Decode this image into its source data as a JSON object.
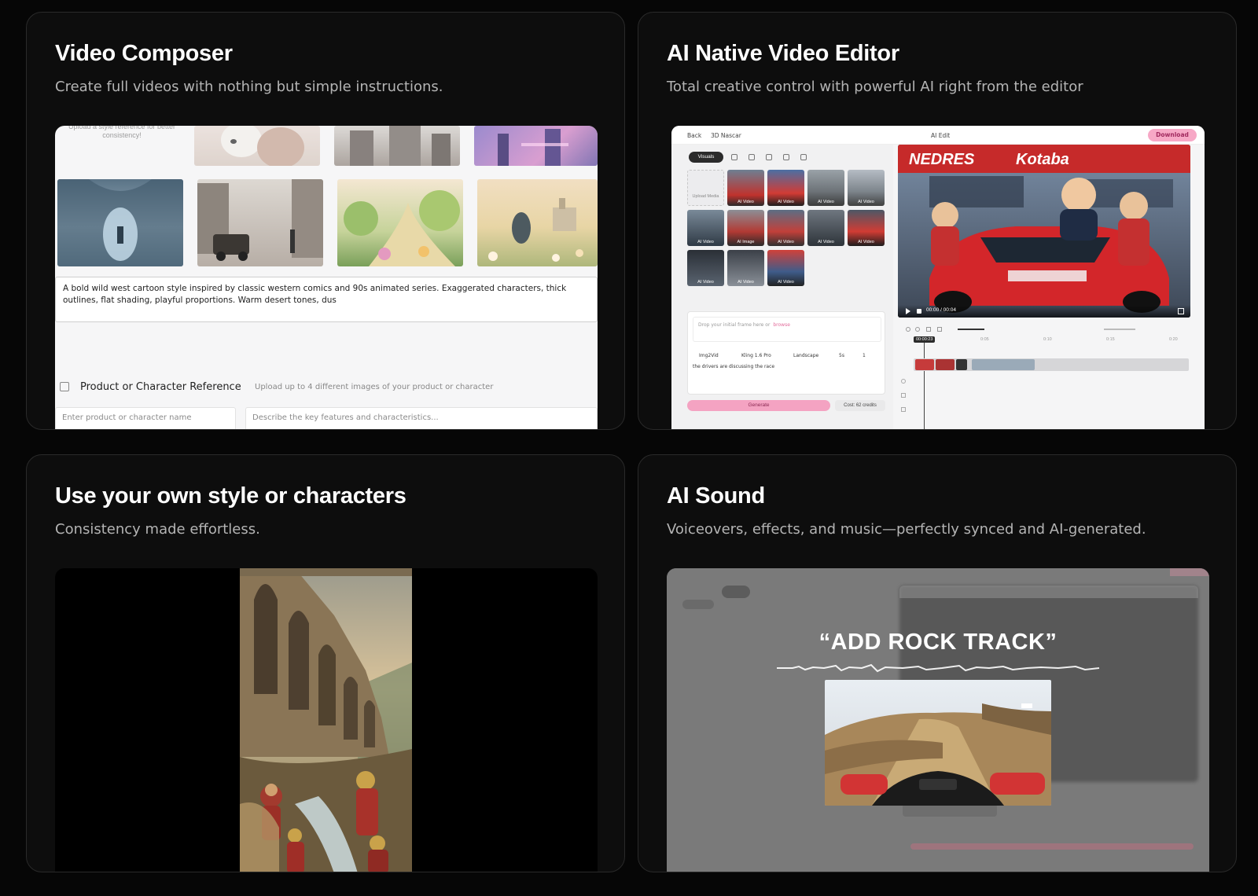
{
  "cards": [
    {
      "title": "Video Composer",
      "subtitle": "Create full videos with nothing but simple instructions.",
      "composer": {
        "upload_hint": "Upload a style reference for better consistency!",
        "prompt_text": "A bold wild west cartoon style inspired by classic western comics and 90s animated series. Exaggerated characters, thick outlines, flat shading, playful proportions. Warm desert tones, dus",
        "reference_title": "Product or Character Reference",
        "reference_hint": "Upload up to 4 different images of your product or character",
        "name_placeholder": "Enter product or character name",
        "features_placeholder": "Describe the key features and characteristics..."
      }
    },
    {
      "title": "AI Native Video Editor",
      "subtitle": "Total creative control with powerful AI right from the editor",
      "editor": {
        "back_label": "Back",
        "project_name": "3D Nascar",
        "ai_edit_label": "AI Edit",
        "download_label": "Download",
        "visuals_tab": "Visuals",
        "upload_media_label": "Upload Media",
        "media_labels": [
          "AI Video",
          "AI Video",
          "AI Video",
          "AI Video",
          "AI Video",
          "AI Image",
          "AI Video",
          "AI Video",
          "AI Video",
          "AI Video",
          "AI Video",
          "AI Video"
        ],
        "prompt_placeholder": "Drop your initial frame here or",
        "prompt_link": "browse",
        "mode_label": "Img2Vid",
        "model_label": "Kling 1.6 Pro",
        "aspect_label": "Landscape",
        "duration_label": "5s",
        "count_label": "1",
        "prompt_text": "the drivers are discussing the race",
        "generate_label": "Generate",
        "cost_label": "Cost: 62 credits",
        "video_time": "00:00 / 00:04",
        "banner_text_left": "NEDRES",
        "banner_text_right": "Kotaba",
        "timeline_current": "00:00:23",
        "timeline_ticks": [
          "0:05",
          "0:10",
          "0:15",
          "0:20"
        ]
      }
    },
    {
      "title": "Use your own style or characters",
      "subtitle": "Consistency made effortless."
    },
    {
      "title": "AI Sound",
      "subtitle": "Voiceovers, effects, and music—perfectly synced and AI-generated.",
      "sound": {
        "caption": "“ADD ROCK TRACK”"
      }
    }
  ],
  "colors": {
    "background": "#060606",
    "card": "#0d0d0d",
    "card_border": "#2a2a2a",
    "accent_pink": "#f4a3c2"
  }
}
